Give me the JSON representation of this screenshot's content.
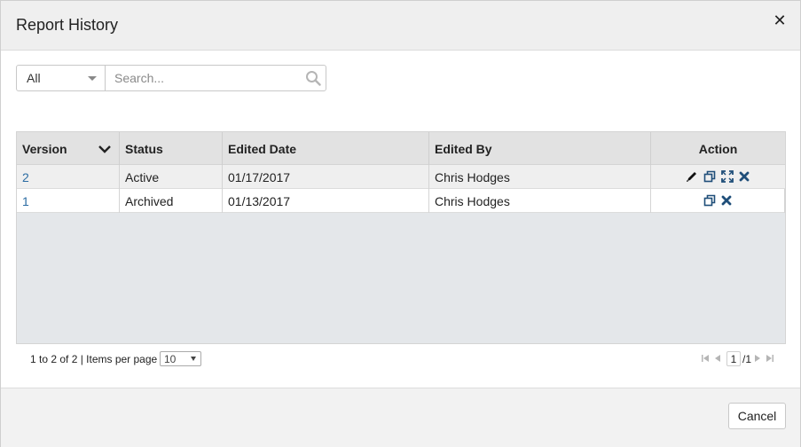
{
  "dialog": {
    "title": "Report History",
    "close_icon": "close-icon"
  },
  "filter": {
    "scope_value": "All",
    "search_placeholder": "Search...",
    "search_icon": "search-icon"
  },
  "table": {
    "columns": [
      "Version",
      "Status",
      "Edited Date",
      "Edited By",
      "Action"
    ],
    "sort_icon": "chevron-down-icon",
    "rows": [
      {
        "version": "2",
        "status": "Active",
        "edited_date": "01/17/2017",
        "edited_by": "Chris Hodges",
        "actions": [
          "edit-icon",
          "copy-icon",
          "expand-icon",
          "delete-icon"
        ]
      },
      {
        "version": "1",
        "status": "Archived",
        "edited_date": "01/13/2017",
        "edited_by": "Chris Hodges",
        "actions": [
          "copy-icon",
          "delete-icon"
        ]
      }
    ]
  },
  "pager": {
    "info": "1 to 2 of 2 | Items per page",
    "items_per_page": "10",
    "current_page": "1",
    "total_pages": "/1"
  },
  "footer": {
    "cancel_label": "Cancel"
  },
  "colors": {
    "link": "#2b6ca3",
    "action_icon": "#1f4e79",
    "header_bg": "#efefef",
    "grid_empty_bg": "#e4e7ea"
  }
}
